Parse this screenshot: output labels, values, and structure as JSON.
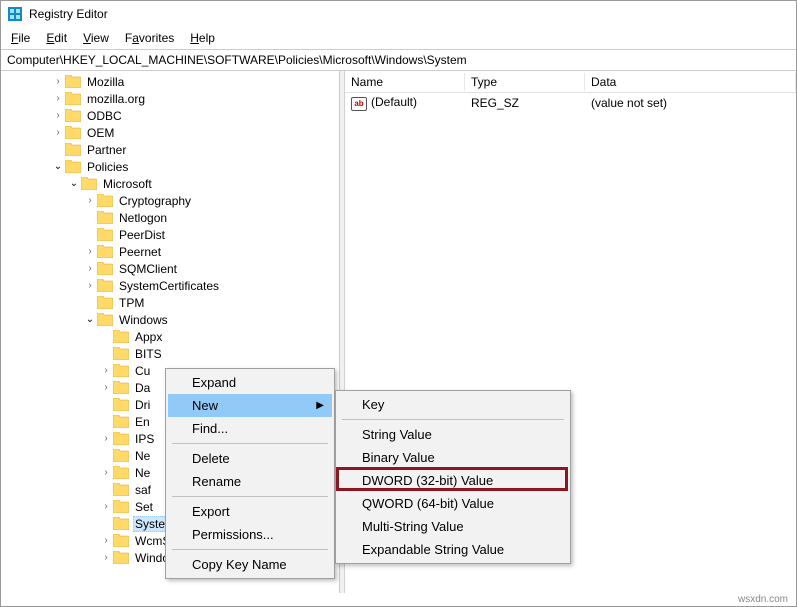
{
  "window": {
    "title": "Registry Editor"
  },
  "menu": {
    "file": "File",
    "edit": "Edit",
    "view": "View",
    "favorites": "Favorites",
    "help": "Help"
  },
  "address": "Computer\\HKEY_LOCAL_MACHINE\\SOFTWARE\\Policies\\Microsoft\\Windows\\System",
  "tree": {
    "mozilla": "Mozilla",
    "mozilla_org": "mozilla.org",
    "odbc": "ODBC",
    "oem": "OEM",
    "partner": "Partner",
    "policies": "Policies",
    "microsoft": "Microsoft",
    "cryptography": "Cryptography",
    "netlogon": "Netlogon",
    "peerdist": "PeerDist",
    "peernet": "Peernet",
    "sqmclient": "SQMClient",
    "systemcertificates": "SystemCertificates",
    "tpm": "TPM",
    "windows": "Windows",
    "appx": "Appx",
    "bits": "BITS",
    "cu": "Cu",
    "da": "Da",
    "dri": "Dri",
    "en": "En",
    "ips": "IPS",
    "ne1": "Ne",
    "ne2": "Ne",
    "saf": "saf",
    "set": "Set",
    "system": "System",
    "wcmsvc": "WcmSvc",
    "windowsupdate": "WindowsUpdate"
  },
  "list": {
    "headers": {
      "name": "Name",
      "type": "Type",
      "data": "Data"
    },
    "rows": [
      {
        "name": "(Default)",
        "type": "REG_SZ",
        "data": "(value not set)"
      }
    ]
  },
  "ctx1": {
    "expand": "Expand",
    "new": "New",
    "find": "Find...",
    "delete": "Delete",
    "rename": "Rename",
    "export": "Export",
    "permissions": "Permissions...",
    "copykeyname": "Copy Key Name"
  },
  "ctx2": {
    "key": "Key",
    "string": "String Value",
    "binary": "Binary Value",
    "dword": "DWORD (32-bit) Value",
    "qword": "QWORD (64-bit) Value",
    "multistring": "Multi-String Value",
    "expandable": "Expandable String Value"
  },
  "watermark": "wsxdn.com"
}
